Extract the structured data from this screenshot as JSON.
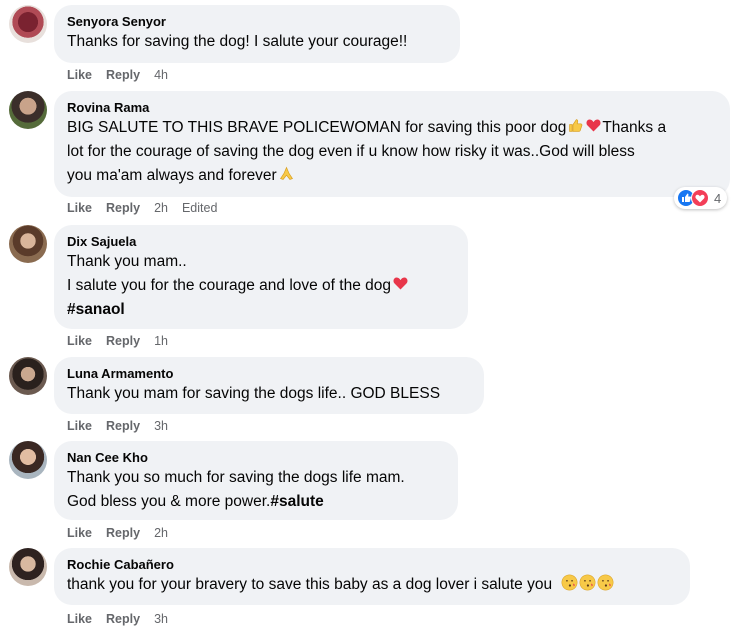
{
  "comments": [
    {
      "name": "Senyora Senyor",
      "lines": [
        "Thanks for saving the dog! I salute your courage!!"
      ],
      "actions": {
        "like": "Like",
        "reply": "Reply",
        "time": "4h"
      }
    },
    {
      "name": "Rovina Rama",
      "lines": [
        "BIG SALUTE TO THIS BRAVE POLICEWOMAN for saving this poor dog",
        "Thanks a",
        "lot for the courage of saving the dog even if u know how risky it was..God will bless",
        "you ma'am always and forever"
      ],
      "actions": {
        "like": "Like",
        "reply": "Reply",
        "time": "2h",
        "edited": "Edited"
      },
      "reactions": {
        "count": "4",
        "icons": [
          "like-reaction",
          "love-reaction"
        ]
      }
    },
    {
      "name": "Dix Sajuela",
      "lines": [
        "Thank you mam..",
        "I salute you for the courage and love of the dog",
        "#sanaol"
      ],
      "actions": {
        "like": "Like",
        "reply": "Reply",
        "time": "1h"
      }
    },
    {
      "name": "Luna Armamento",
      "lines": [
        "Thank you mam for saving the dogs life.. GOD BLESS"
      ],
      "actions": {
        "like": "Like",
        "reply": "Reply",
        "time": "3h"
      }
    },
    {
      "name": "Nan Cee Kho",
      "lines": [
        "Thank you so much for saving the dogs life mam.",
        "God bless you & more power.",
        "#salute"
      ],
      "actions": {
        "like": "Like",
        "reply": "Reply",
        "time": "2h"
      }
    },
    {
      "name": "Rochie Cabañero",
      "lines": [
        "thank you for your bravery to save this baby as a dog lover i salute you"
      ],
      "actions": {
        "like": "Like",
        "reply": "Reply",
        "time": "3h"
      }
    }
  ],
  "colors": {
    "bubble": "#f0f2f5",
    "name": "#050505",
    "meta": "#65676b",
    "like_reaction": "#1877f2",
    "love_reaction": "#f33e58"
  }
}
